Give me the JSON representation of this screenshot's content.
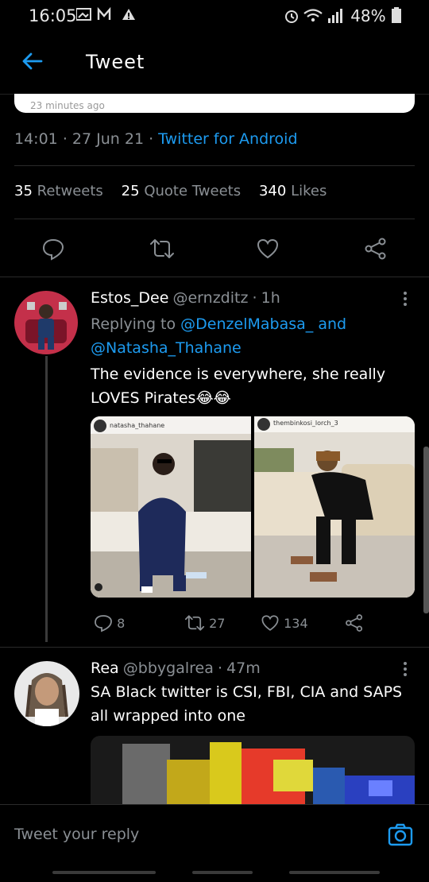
{
  "status_bar": {
    "time": "16:05",
    "battery": "48%"
  },
  "header": {
    "title": "Tweet"
  },
  "quoted_card": {
    "timestamp": "23 minutes ago"
  },
  "tweet_meta": {
    "time": "14:01",
    "date": "27 Jun 21",
    "source": "Twitter for Android"
  },
  "stats": {
    "retweets_count": "35",
    "retweets_label": "Retweets",
    "quote_count": "25",
    "quote_label": "Quote Tweets",
    "likes_count": "340",
    "likes_label": "Likes"
  },
  "replies": [
    {
      "name": "Estos_Dee",
      "handle": "@ernzditz",
      "age": "1h",
      "replying_label": "Replying to",
      "replying_to_1": "@DenzelMabasa_",
      "replying_and": "and",
      "replying_to_2": "@Natasha_Thahane",
      "text": "The evidence is everywhere, she really LOVES Pirates😂😂",
      "image1_user": "natasha_thahane",
      "image2_user": "thembinkosi_lorch_3",
      "replies": "8",
      "retweets": "27",
      "likes": "134"
    },
    {
      "name": "Rea",
      "handle": "@bbygalrea",
      "age": "47m",
      "text": "SA Black twitter is CSI, FBI, CIA and SAPS all wrapped into one"
    }
  ],
  "composer": {
    "placeholder": "Tweet your reply"
  },
  "colors": {
    "accent": "#1d9bf0",
    "muted": "#8a8f94",
    "background": "#000000"
  }
}
